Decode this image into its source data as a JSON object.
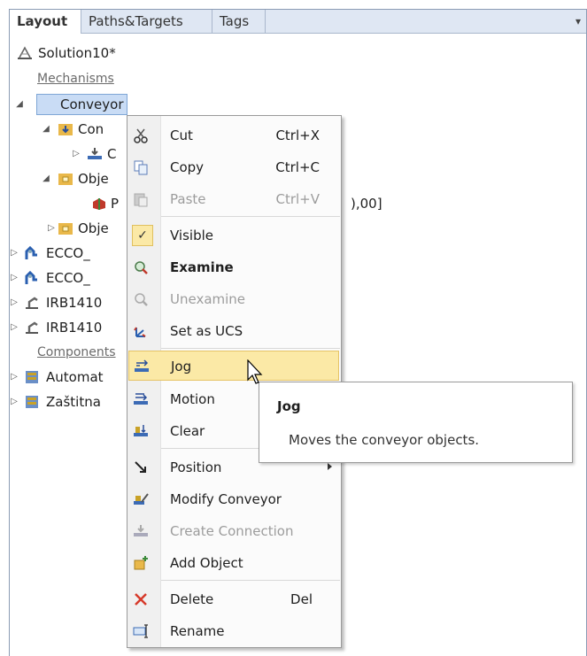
{
  "tabs": [
    "Layout",
    "Paths&Targets",
    "Tags"
  ],
  "tab_menu_glyph": "▾",
  "tree": {
    "root": "Solution10*",
    "mechanisms_header": "Mechanisms",
    "conveyor": "Conveyor",
    "conn_partial": "Con",
    "conn_child_partial": "C",
    "obje1_partial": "Obje",
    "p_child_partial": "P",
    "p_child_value_partial": "),00]",
    "obje2_partial": "Obje",
    "ecco1_partial": "ECCO_",
    "ecco2_partial": "ECCO_",
    "irb1_partial": "IRB1410",
    "irb2_partial": "IRB1410",
    "components_header": "Components",
    "automat_partial": "Automat",
    "zastitna_partial": "Zaštitna"
  },
  "menu": {
    "cut": "Cut",
    "cut_shortcut": "Ctrl+X",
    "copy": "Copy",
    "copy_shortcut": "Ctrl+C",
    "paste": "Paste",
    "paste_shortcut": "Ctrl+V",
    "visible": "Visible",
    "examine": "Examine",
    "unexamine": "Unexamine",
    "set_ucs": "Set as UCS",
    "jog": "Jog",
    "motion": "Motion",
    "clear": "Clear",
    "position": "Position",
    "modify_conveyor": "Modify Conveyor",
    "create_connection": "Create Connection",
    "add_object": "Add Object",
    "delete": "Delete",
    "delete_shortcut": "Del",
    "rename": "Rename"
  },
  "tooltip": {
    "title": "Jog",
    "description": "Moves the conveyor objects."
  }
}
